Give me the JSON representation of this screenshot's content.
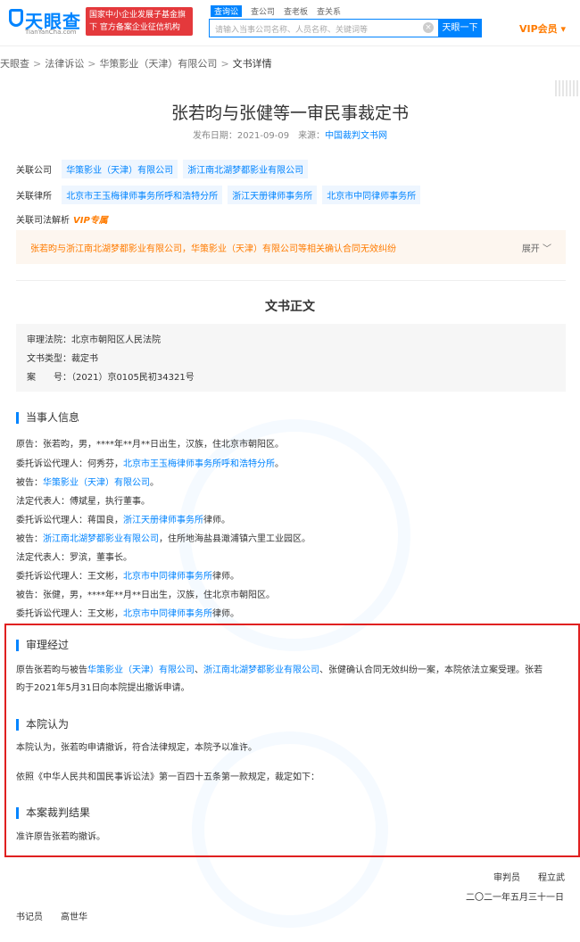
{
  "header": {
    "logo_text": "天眼查",
    "logo_sub": "TianYanCha.com",
    "badge": "国家中小企业发展子基金旗下 官方备案企业征信机构",
    "search_tabs": [
      "查询讼",
      "查公司",
      "查老板",
      "查关系"
    ],
    "search_placeholder": "请输入当事公司名称、人员名称、关键词等",
    "search_button": "天眼一下",
    "vip": "VIP会员"
  },
  "breadcrumb": [
    "天眼查",
    "法律诉讼",
    "华策影业（天津）有限公司",
    "文书详情"
  ],
  "document": {
    "title": "张若昀与张健等一审民事裁定书",
    "publish_date": "发布日期：2021-09-09",
    "source_label": "来源：",
    "source": "中国裁判文书网"
  },
  "relations": {
    "company_label": "关联公司",
    "companies": [
      "华策影业（天津）有限公司",
      "浙江南北湖梦都影业有限公司"
    ],
    "lawfirm_label": "关联律所",
    "lawfirms": [
      "北京市王玉梅律师事务所呼和浩特分所",
      "浙江天册律师事务所",
      "北京市中同律师事务所"
    ],
    "analysis_label": "关联司法解析",
    "analysis_vip": "VIP专属"
  },
  "notice": {
    "text": "张若昀与浙江南北湖梦都影业有限公司，华策影业（天津）有限公司等相关确认合同无效纠纷",
    "expand": "展开"
  },
  "body_title": "文书正文",
  "info": {
    "court": "审理法院：北京市朝阳区人民法院",
    "type": "文书类型：裁定书",
    "case_no": "案　　号：（2021）京0105民初34321号"
  },
  "parties_title": "当事人信息",
  "parties": [
    {
      "text": "原告：张若昀，男，****年**月**日出生，汉族，住北京市朝阳区。"
    },
    {
      "prefix": "委托诉讼代理人：何秀芬，",
      "link": "北京市王玉梅律师事务所呼和浩特分所",
      "suffix": "。"
    },
    {
      "prefix": "被告：",
      "link": "华策影业（天津）有限公司",
      "suffix": "。"
    },
    {
      "text": "法定代表人：傅斌星，执行董事。"
    },
    {
      "prefix": "委托诉讼代理人：蒋国良，",
      "link": "浙江天册律师事务所",
      "suffix": "律师。"
    },
    {
      "prefix": "被告：",
      "link": "浙江南北湖梦都影业有限公司",
      "suffix": "，住所地海盐县澉浦镇六里工业园区。"
    },
    {
      "text": "法定代表人：罗滨，董事长。"
    },
    {
      "prefix": "委托诉讼代理人：王文彬，",
      "link": "北京市中同律师事务所",
      "suffix": "律师。"
    },
    {
      "text": "被告：张健，男，****年**月**日出生，汉族，住北京市朝阳区。"
    },
    {
      "prefix": "委托诉讼代理人：王文彬，",
      "link": "北京市中同律师事务所",
      "suffix": "律师。"
    }
  ],
  "trial": {
    "title": "审理经过",
    "p1_a": "原告张若昀与被告",
    "p1_link1": "华策影业（天津）有限公司",
    "p1_b": "、",
    "p1_link2": "浙江南北湖梦都影业有限公司",
    "p1_c": "、张健确认合同无效纠纷一案，本院依法立案受理。张若",
    "p1_d": "昀于2021年5月31日向本院提出撤诉申请。"
  },
  "opinion": {
    "title": "本院认为",
    "p1": "本院认为，张若昀申请撤诉，符合法律规定，本院予以准许。",
    "p2": "依照《中华人民共和国民事诉讼法》第一百四十五条第一款规定，裁定如下："
  },
  "result": {
    "title": "本案裁判结果",
    "p1": "准许原告张若昀撤诉。"
  },
  "signature": {
    "judge": "审判员　　程立武",
    "date": "二〇二一年五月三十一日",
    "clerk": "书记员　　高世华"
  }
}
